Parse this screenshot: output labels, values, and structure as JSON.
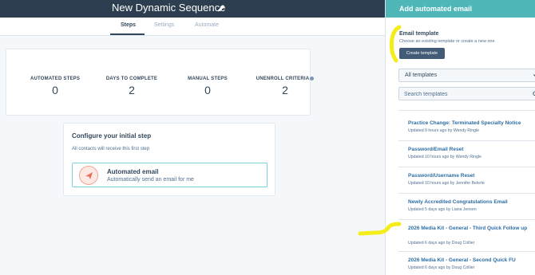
{
  "sequence": {
    "title": "New Dynamic Sequence"
  },
  "tabs": [
    {
      "label": "Steps",
      "active": true
    },
    {
      "label": "Settings",
      "active": false
    },
    {
      "label": "Automate",
      "active": false
    }
  ],
  "stats": [
    {
      "label": "AUTOMATED STEPS",
      "value": "0"
    },
    {
      "label": "DAYS TO COMPLETE",
      "value": "2"
    },
    {
      "label": "MANUAL STEPS",
      "value": "0"
    },
    {
      "label": "UNENROLL CRITERIA",
      "value": "2"
    }
  ],
  "configure": {
    "title": "Configure your initial step",
    "subtitle": "All contacts will receive this first step",
    "option_title": "Automated email",
    "option_desc": "Automatically send an email for me",
    "option_icon": "paper-plane-icon"
  },
  "panel": {
    "title": "Add automated email",
    "section_label": "Email template",
    "section_sub": "Choose an existing template or create a new one",
    "create_button": "Create template",
    "filter_value": "All templates",
    "search_placeholder": "Search templates"
  },
  "templates": [
    {
      "title": "Practice Change: Terminated Specialty Notice",
      "meta": "Updated 9 hours ago by Wendy Ringle"
    },
    {
      "title": "Password/Email Reset",
      "meta": "Updated 10 hours ago by Wendy Ringle"
    },
    {
      "title": "Password/Username Reset",
      "meta": "Updated 10 hours ago by Jennifer Belerle"
    },
    {
      "title": "Newly Accredited Congratulations Email",
      "meta": "Updated 5 days ago by Liana Jensen"
    },
    {
      "title": "2026 Media Kit - General - Third Quick Follow up",
      "meta": "Updated 6 days ago by Doug Collier"
    },
    {
      "title": "2026 Media Kit - General - Second Quick FU",
      "meta": "Updated 6 days ago by Doug Collier"
    }
  ],
  "colors": {
    "header_dark": "#2d3e50",
    "panel_header": "#4fb7b8",
    "link_blue": "#2d6da3",
    "annotation_yellow": "#f5ec1b"
  }
}
